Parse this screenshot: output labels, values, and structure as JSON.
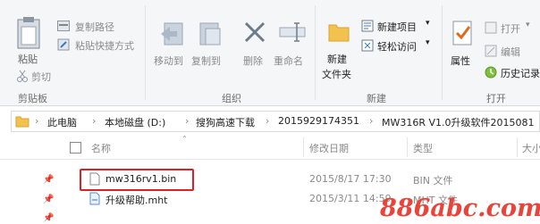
{
  "ribbon": {
    "clipboard": {
      "pin_label": "粘贴",
      "paste_label": "粘贴",
      "copy_path": "复制路径",
      "paste_shortcut": "粘贴快捷方式",
      "cut": "剪切",
      "group": "剪贴板"
    },
    "organize": {
      "move_to": "移动到",
      "copy_to": "复制到",
      "delete": "删除",
      "rename": "重命名",
      "group": "组织"
    },
    "new": {
      "new_folder_line1": "新建",
      "new_folder_line2": "文件夹",
      "new_item": "新建项目",
      "easy_access": "轻松访问",
      "group": "新建"
    },
    "open": {
      "properties": "属性",
      "open": "打开",
      "edit": "编辑",
      "history": "历史记录",
      "group": "打开"
    }
  },
  "breadcrumb": [
    "此电脑",
    "本地磁盘 (D:)",
    "搜狗高速下载",
    "2015929174351",
    "MW316R V1.0升级软件2015081"
  ],
  "columns": {
    "name": "名称",
    "modified": "修改日期",
    "type": "类型",
    "size": "大小"
  },
  "files": [
    {
      "name": "mw316rv1.bin",
      "modified": "2015/8/17 17:30",
      "type": "BIN 文件"
    },
    {
      "name": "升级帮助.mht",
      "modified": "2015/3/11 14:59",
      "type": "MHT 文件"
    }
  ],
  "watermark": "886abc.com",
  "colors": {
    "highlight": "#e02020",
    "accent": "#2b7bd3",
    "folder": "#f2c14e"
  }
}
